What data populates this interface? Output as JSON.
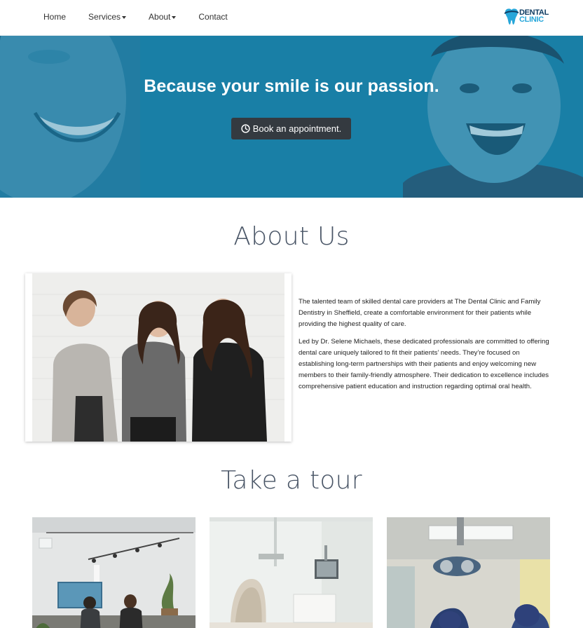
{
  "nav": {
    "items": [
      {
        "label": "Home",
        "dropdown": false
      },
      {
        "label": "Services",
        "dropdown": true
      },
      {
        "label": "About",
        "dropdown": true
      },
      {
        "label": "Contact",
        "dropdown": false
      }
    ],
    "brand": {
      "line1": "DENTAL",
      "line2": "CLINIC",
      "icon": "tooth-icon"
    }
  },
  "hero": {
    "title": "Because your smile is our passion.",
    "button_label": "Book an appointment.",
    "button_icon": "clock-icon",
    "overlay_color": "#1c83aa"
  },
  "about": {
    "title": "About Us",
    "paragraphs": [
      "The talented team of skilled dental care providers at The Dental Clinic and Family Dentistry in Sheffield, create a comfortable environment for their patients while providing the highest quality of care.",
      "Led by Dr. Selene Michaels, these dedicated professionals are committed to offering dental care uniquely tailored to fit their patients’ needs. They’re focused on establishing long-term partnerships with their patients and enjoy welcoming new members to their family-friendly atmosphere. Their dedication to excellence includes comprehensive patient education and instruction regarding optimal oral health."
    ]
  },
  "tour": {
    "title": "Take a tour"
  },
  "colors": {
    "hero_blue": "#1c83aa",
    "button_dark": "#343a40",
    "heading_gray": "#495566",
    "brand_dark": "#0f3d63",
    "brand_light": "#27a6d9"
  }
}
